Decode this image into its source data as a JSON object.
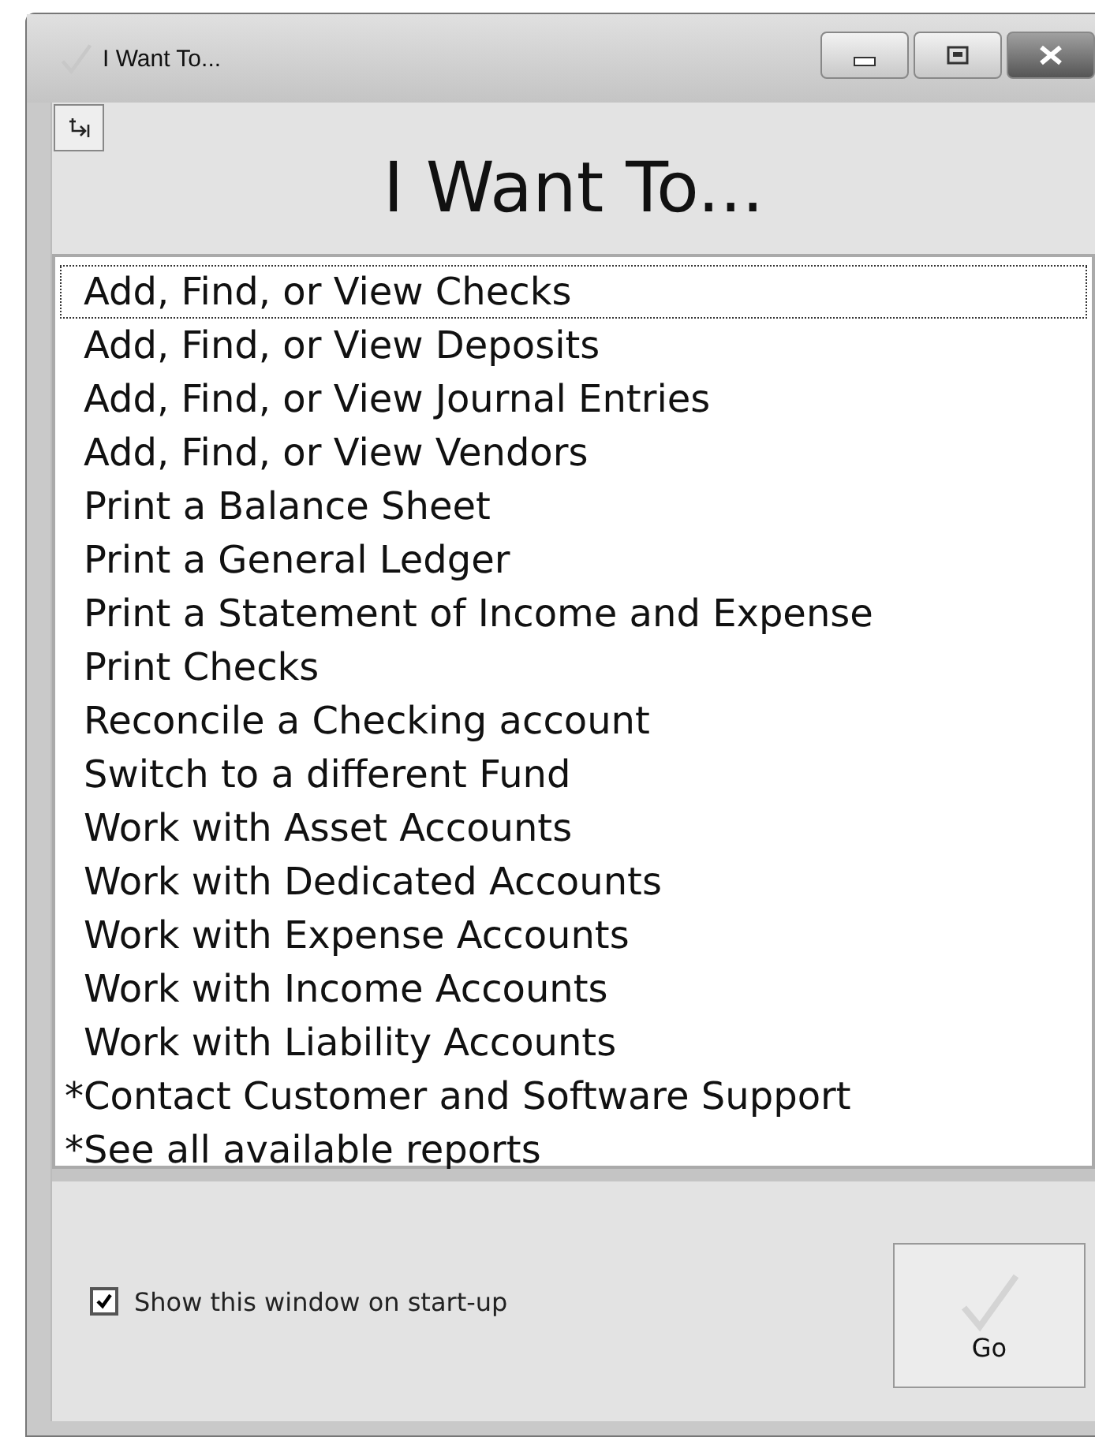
{
  "window": {
    "title": "I Want To..."
  },
  "heading": "I Want To...",
  "list": {
    "items": [
      {
        "label": "Add, Find, or View Checks",
        "selected": false,
        "focused": true
      },
      {
        "label": "Add, Find, or View Deposits",
        "selected": false,
        "focused": false
      },
      {
        "label": "Add, Find, or View Journal Entries",
        "selected": false,
        "focused": false
      },
      {
        "label": "Add, Find, or View Vendors",
        "selected": false,
        "focused": false
      },
      {
        "label": "Print a Balance Sheet",
        "selected": false,
        "focused": false
      },
      {
        "label": "Print a General Ledger",
        "selected": false,
        "focused": false
      },
      {
        "label": "Print a Statement of Income and Expense",
        "selected": false,
        "focused": false
      },
      {
        "label": "Print Checks",
        "selected": false,
        "focused": false
      },
      {
        "label": "Reconcile a Checking account",
        "selected": false,
        "focused": false
      },
      {
        "label": "Switch to a different Fund",
        "selected": false,
        "focused": false
      },
      {
        "label": "Work with Asset Accounts",
        "selected": false,
        "focused": false
      },
      {
        "label": "Work with Dedicated Accounts",
        "selected": false,
        "focused": false
      },
      {
        "label": "Work with Expense Accounts",
        "selected": false,
        "focused": false
      },
      {
        "label": "Work with Income Accounts",
        "selected": false,
        "focused": false
      },
      {
        "label": "Work with Liability Accounts",
        "selected": false,
        "focused": false
      },
      {
        "label": "*Contact Customer and Software Support",
        "selected": false,
        "focused": false
      },
      {
        "label": "*See all available reports",
        "selected": false,
        "focused": false
      }
    ]
  },
  "startup_checkbox": {
    "label": "Show this window on start-up",
    "checked": true
  },
  "go_button": {
    "label": "Go"
  }
}
